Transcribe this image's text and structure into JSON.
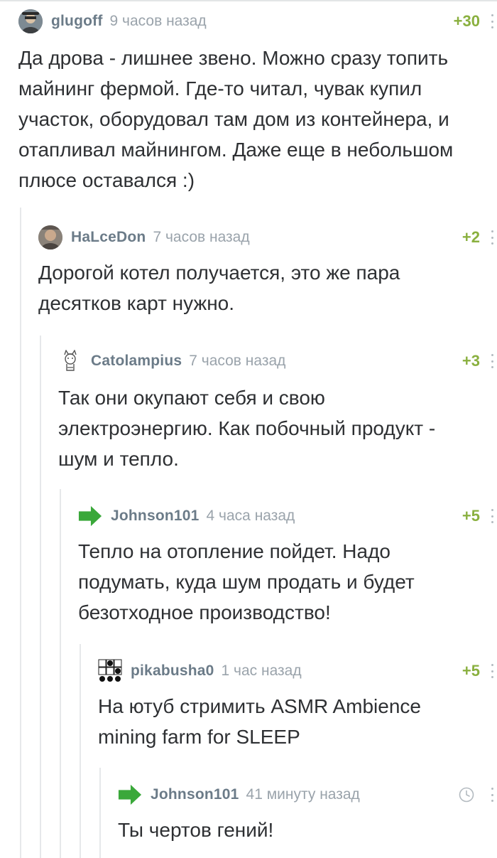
{
  "colors": {
    "username": "#6b7b88",
    "time": "#9aa3ab",
    "rating": "#8ab03f",
    "text": "#2e3033",
    "rail": "#e6e8ea",
    "arrow": "#3aa83a"
  },
  "comments": [
    {
      "avatar_icon": "user-photo",
      "username": "glugoff",
      "time": "9 часов назад",
      "rating": "+30",
      "text": "Да дрова - лишнее звено. Можно сразу топить майнинг фермой. Где-то читал, чувак купил участок, оборудовал там дом из контейнера, и отапливал майнингом. Даже еще в небольшом плюсе оставался :)"
    },
    {
      "avatar_icon": "user-photo",
      "username": "HaLceDon",
      "time": "7 часов назад",
      "rating": "+2",
      "text": "Дорогой котел получается, это же пара десятков карт нужно."
    },
    {
      "avatar_icon": "cat-sketch",
      "username": "Catolampius",
      "time": "7 часов назад",
      "rating": "+3",
      "text": "Так они окупают себя и свою электроэнергию. Как побочный продукт - шум и тепло."
    },
    {
      "avatar_icon": "green-arrow",
      "username": "Johnson101",
      "time": "4 часа назад",
      "rating": "+5",
      "text": "Тепло на отопление пойдет. Надо подумать, куда шум продать и будет безотходное производство!"
    },
    {
      "avatar_icon": "pixel-grid",
      "username": "pikabusha0",
      "time": "1 час назад",
      "rating": "+5",
      "text": "На ютуб стримить ASMR Ambience mining farm for SLEEP"
    },
    {
      "avatar_icon": "green-arrow",
      "username": "Johnson101",
      "time": "41 минуту назад",
      "rating": "",
      "text": "Ты чертов гений!"
    }
  ]
}
